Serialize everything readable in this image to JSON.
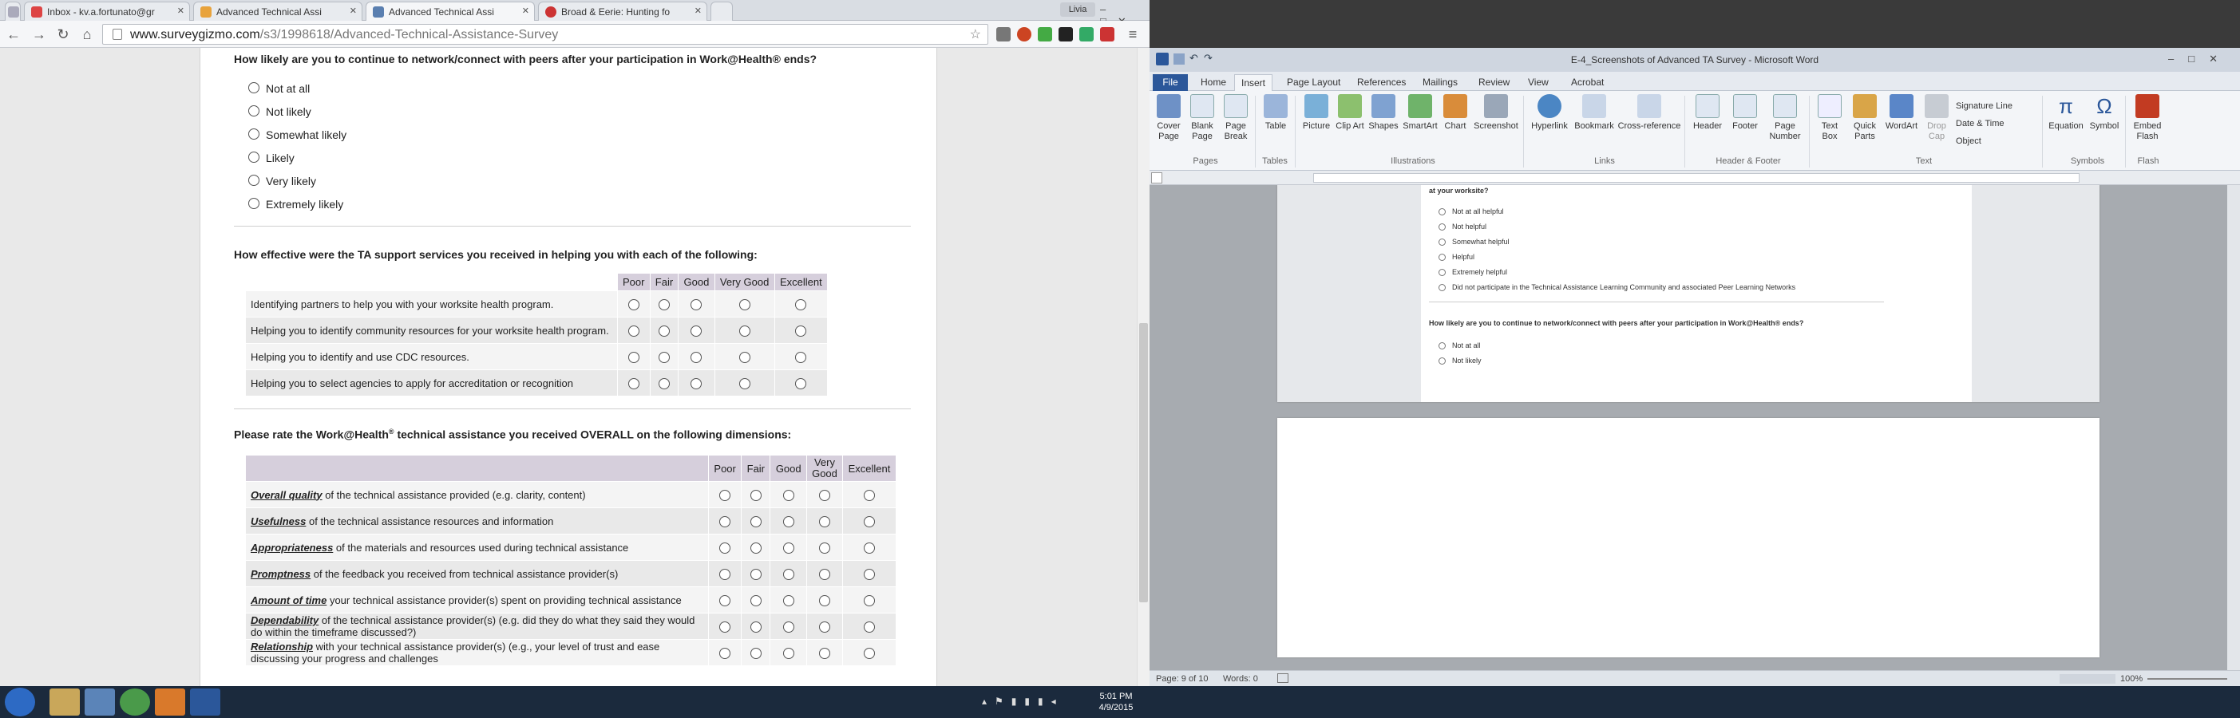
{
  "browser": {
    "tabs": [
      {
        "label": "Inbox - kv.a.fortunato@gr",
        "active": false
      },
      {
        "label": "Advanced Technical Assi",
        "active": false
      },
      {
        "label": "Advanced Technical Assi",
        "active": true
      },
      {
        "label": "Broad & Eerie: Hunting fo",
        "active": false
      }
    ],
    "url_host": "www.surveygizmo.com",
    "url_path": "/s3/1998618/Advanced-Technical-Assistance-Survey",
    "profile": "Livia"
  },
  "survey": {
    "q1": {
      "text": "How likely are you to continue to network/connect with peers after your participation in Work@Health® ends?",
      "options": [
        "Not at all",
        "Not likely",
        "Somewhat likely",
        "Likely",
        "Very likely",
        "Extremely likely"
      ]
    },
    "q2": {
      "text": "How effective were the TA support services you received in helping you with each of the following:",
      "columns": [
        "Poor",
        "Fair",
        "Good",
        "Very Good",
        "Excellent"
      ],
      "rows": [
        "Identifying partners to help you with your worksite health program.",
        "Helping you to identify community resources for your worksite health program.",
        "Helping you to identify and use CDC resources.",
        "Helping you to select agencies to apply for accreditation or recognition"
      ]
    },
    "q3": {
      "text_before": "Please rate the Work@Health",
      "text_sup": "®",
      "text_after": " technical assistance you received OVERALL on the following dimensions:",
      "columns": [
        "Poor",
        "Fair",
        "Good",
        "Very Good",
        "Excellent"
      ],
      "rows": [
        {
          "dim": "Overall quality",
          "rest": " of the technical assistance provided (e.g. clarity, content)"
        },
        {
          "dim": "Usefulness",
          "rest": " of the technical assistance resources and information"
        },
        {
          "dim": "Appropriateness",
          "rest": " of the materials and resources used during technical assistance"
        },
        {
          "dim": "Promptness",
          "rest": " of the feedback you received from technical assistance provider(s)"
        },
        {
          "dim": "Amount of time",
          "rest": " your technical assistance provider(s) spent on providing technical assistance"
        },
        {
          "dim": "Dependability",
          "rest": " of the technical assistance provider(s) (e.g. did they do what they said they would do within the timeframe discussed?)"
        },
        {
          "dim": "Relationship",
          "rest": " with your technical assistance provider(s) (e.g., your level of trust and ease discussing your progress and challenges"
        }
      ]
    }
  },
  "word": {
    "title": "E-4_Screenshots of Advanced TA Survey - Microsoft Word",
    "tabs": [
      "File",
      "Home",
      "Insert",
      "Page Layout",
      "References",
      "Mailings",
      "Review",
      "View",
      "Acrobat"
    ],
    "active_tab": "Insert",
    "ribbon_buttons": [
      "Cover Page",
      "Blank Page",
      "Page Break",
      "Table",
      "Picture",
      "Clip Art",
      "Shapes",
      "SmartArt",
      "Chart",
      "Screenshot",
      "Hyperlink",
      "Bookmark",
      "Cross-reference",
      "Header",
      "Footer",
      "Page Number",
      "Text Box",
      "Quick Parts",
      "WordArt",
      "Drop Cap",
      "Equation",
      "Symbol",
      "Embed Flash"
    ],
    "ribbon_small": [
      "Signature Line",
      "Date & Time",
      "Object"
    ],
    "groups": [
      "Pages",
      "Tables",
      "Illustrations",
      "Links",
      "Header & Footer",
      "Text",
      "Symbols",
      "Flash"
    ],
    "doc_q_prev_tail": "at your worksite?",
    "doc_options": [
      "Not at all helpful",
      "Not helpful",
      "Somewhat helpful",
      "Helpful",
      "Extremely helpful",
      "Did not participate in the Technical Assistance Learning Community and associated Peer Learning Networks"
    ],
    "doc_q_next": "How likely are you to continue to network/connect with peers after your participation in Work@Health® ends?",
    "doc_q_next_options": [
      "Not at all",
      "Not likely"
    ],
    "status_page": "Page: 9 of 10",
    "status_words": "Words: 0",
    "zoom": "100%"
  },
  "taskbar": {
    "time": "5:01 PM",
    "date": "4/9/2015"
  }
}
